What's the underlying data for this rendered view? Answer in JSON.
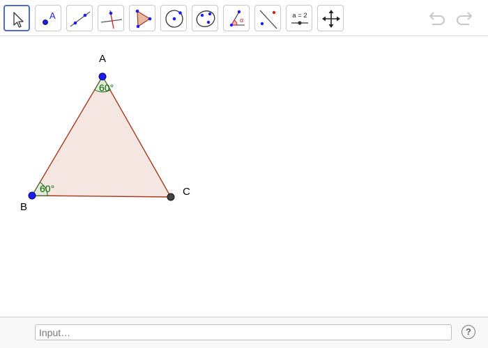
{
  "toolbar": {
    "tools": [
      {
        "name": "move-tool",
        "selected": true
      },
      {
        "name": "point-tool",
        "icon_label": "A"
      },
      {
        "name": "line-tool"
      },
      {
        "name": "perpendicular-line-tool"
      },
      {
        "name": "polygon-tool"
      },
      {
        "name": "circle-center-point-tool"
      },
      {
        "name": "conic-five-points-tool"
      },
      {
        "name": "angle-tool",
        "icon_label": "α"
      },
      {
        "name": "reflect-about-line-tool"
      },
      {
        "name": "slider-tool",
        "icon_label": "a = 2"
      },
      {
        "name": "move-graphics-view-tool"
      }
    ],
    "undo_icon": "undo-icon",
    "redo_icon": "redo-icon"
  },
  "canvas": {
    "points": [
      {
        "label": "A",
        "color": "#1c1cf5"
      },
      {
        "label": "B",
        "color": "#1c1cf5"
      },
      {
        "label": "C",
        "color": "#444444"
      }
    ],
    "polygon": {
      "fill": "#f5e6e1",
      "stroke": "#a33a1e"
    },
    "angles": [
      {
        "vertex": "A",
        "label": "60°",
        "color": "#006400"
      },
      {
        "vertex": "B",
        "label": "60°",
        "color": "#006400"
      }
    ]
  },
  "input_bar": {
    "placeholder": "Input…",
    "help_label": "?"
  }
}
